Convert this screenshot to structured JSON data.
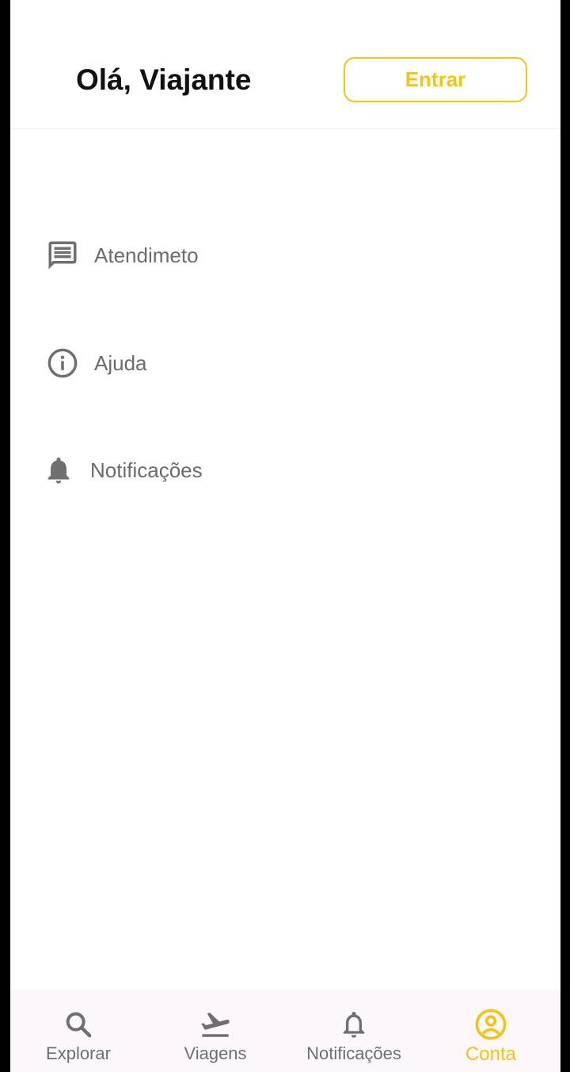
{
  "header": {
    "greeting": "Olá, Viajante",
    "login_label": "Entrar"
  },
  "menu": {
    "items": [
      {
        "label": "Atendimeto",
        "icon": "chat-icon"
      },
      {
        "label": "Ajuda",
        "icon": "info-icon"
      },
      {
        "label": "Notificações",
        "icon": "bell-icon"
      }
    ]
  },
  "tabbar": {
    "tabs": [
      {
        "label": "Explorar",
        "icon": "search-icon"
      },
      {
        "label": "Viagens",
        "icon": "flight-departure-icon"
      },
      {
        "label": "Notificações",
        "icon": "bell-outline-icon"
      },
      {
        "label": "Conta",
        "icon": "account-circle-icon",
        "active": true
      }
    ]
  },
  "colors": {
    "accent": "#f2c511",
    "text_muted": "#6b6b6b",
    "icon_gray": "#6f6f6f",
    "tabbar_bg": "#fcf7fb"
  }
}
